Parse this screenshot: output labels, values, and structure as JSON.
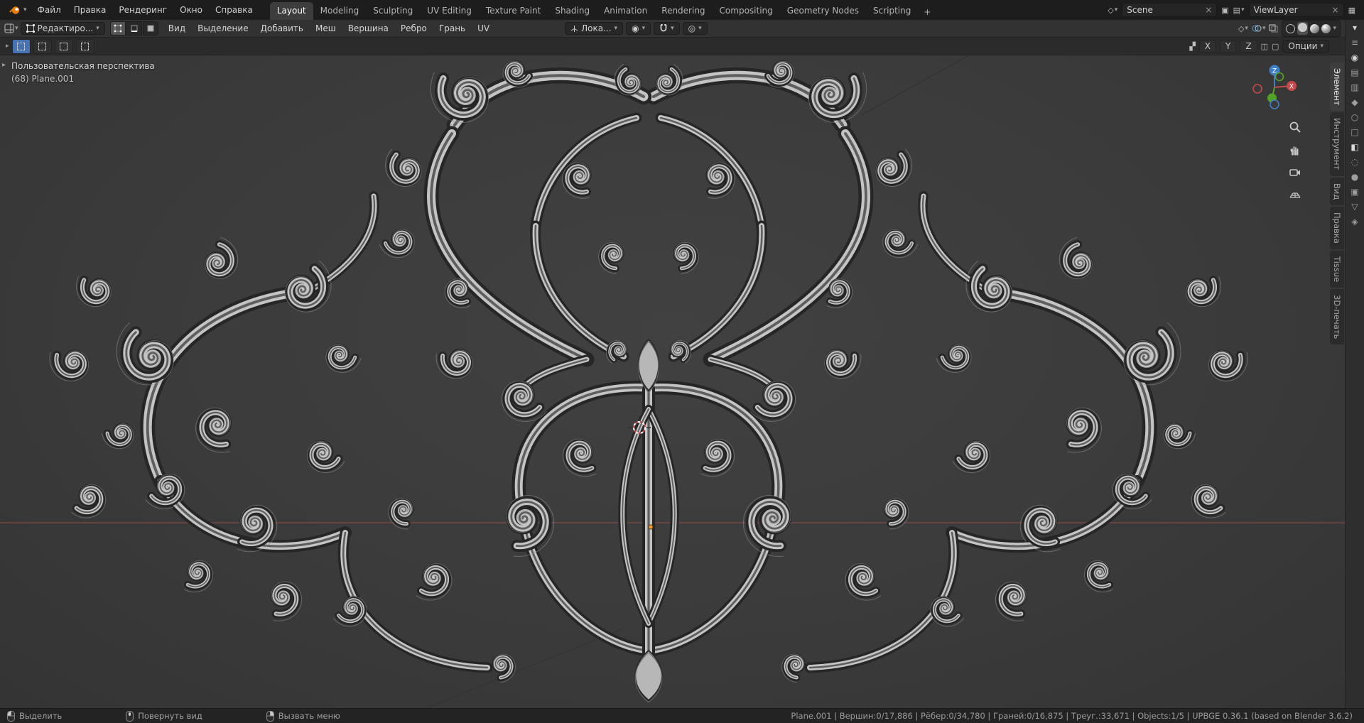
{
  "topbar": {
    "menus": [
      "Файл",
      "Правка",
      "Рендеринг",
      "Окно",
      "Справка"
    ],
    "workspaces": [
      "Layout",
      "Modeling",
      "Sculpting",
      "UV Editing",
      "Texture Paint",
      "Shading",
      "Animation",
      "Rendering",
      "Compositing",
      "Geometry Nodes",
      "Scripting"
    ],
    "workspace_add": "+",
    "scene": "Scene",
    "view_layer": "ViewLayer"
  },
  "vph": {
    "mode": "Редактиро...",
    "menus": [
      "Вид",
      "Выделение",
      "Добавить",
      "Меш",
      "Вершина",
      "Ребро",
      "Грань",
      "UV"
    ],
    "orientation": "Лока..."
  },
  "tools": {
    "axes": [
      "X",
      "Y",
      "Z"
    ],
    "options": "Опции"
  },
  "viewport": {
    "view_label": "Пользовательская перспектива",
    "object_label": "(68) Plane.001"
  },
  "npanel": {
    "tabs": [
      "Элемент",
      "Инструмент",
      "Вид",
      "Правка",
      "Tissue",
      "3D-печать"
    ]
  },
  "right_strip": {
    "icons": [
      {
        "name": "tool-icon",
        "glyph": "≡"
      },
      {
        "name": "render-icon",
        "glyph": "◉"
      },
      {
        "name": "output-icon",
        "glyph": "▤"
      },
      {
        "name": "view-layer-icon",
        "glyph": "▥"
      },
      {
        "name": "scene-icon",
        "glyph": "◆"
      },
      {
        "name": "world-icon",
        "glyph": "○"
      },
      {
        "name": "object-icon",
        "glyph": "□"
      },
      {
        "name": "modifiers-icon",
        "glyph": "◧"
      },
      {
        "name": "particles-icon",
        "glyph": "◌"
      },
      {
        "name": "physics-icon",
        "glyph": "●"
      },
      {
        "name": "constraints-icon",
        "glyph": "▣"
      },
      {
        "name": "object-data-icon",
        "glyph": "▽"
      },
      {
        "name": "material-icon",
        "glyph": "◈"
      }
    ]
  },
  "statusbar": {
    "hints": [
      "Выделить",
      "Повернуть вид",
      "Вызвать меню"
    ],
    "stats": "Plane.001 | Вершин:0/17,886 | Рёбер:0/34,780 | Граней:0/16,875 | Треуг.:33,671 | Objects:1/5 | UPBGE 0.36.1 (based on Blender 3.6.2)"
  },
  "colors": {
    "accent": "#4772b3",
    "axis_x": "#c4494b",
    "axis_y": "#54a327",
    "axis_z": "#3f7fc4",
    "ornament_light": "#c4c4c4",
    "viewport_bg": "#3b3b3b"
  }
}
